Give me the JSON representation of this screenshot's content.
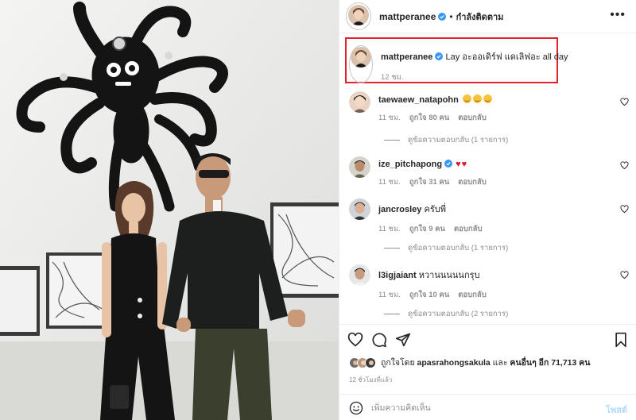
{
  "post": {
    "username": "mattperanee",
    "separator": "•",
    "follow_status": "กำลังติดตาม",
    "more_icon": "more-horizontal-icon"
  },
  "caption": {
    "username": "mattperanee",
    "text": "Lay อะออเดิร์ฟ แดเลิฟอะ all day",
    "time": "12 ชม."
  },
  "comments": [
    {
      "username": "taewaew_natapohn",
      "text": "",
      "emojis": [
        "grinning-face",
        "grinning-face",
        "grinning-face"
      ],
      "time": "11 ชม.",
      "likes": "ถูกใจ 80 คน",
      "reply": "ตอบกลับ",
      "view_replies": "ดูข้อความตอบกลับ (1 รายการ)",
      "verified": false
    },
    {
      "username": "ize_pitchapong",
      "text": "",
      "emojis": [
        "red-heart",
        "red-heart"
      ],
      "time": "11 ชม.",
      "likes": "ถูกใจ 31 คน",
      "reply": "ตอบกลับ",
      "view_replies": "",
      "verified": true
    },
    {
      "username": "jancrosley",
      "text": "ครับพี่",
      "emojis": [],
      "time": "11 ชม.",
      "likes": "ถูกใจ 9 คน",
      "reply": "ตอบกลับ",
      "view_replies": "ดูข้อความตอบกลับ (1 รายการ)",
      "verified": false
    },
    {
      "username": "l3igjaiant",
      "text": "หวานนนนนกรุบ",
      "emojis": [],
      "time": "11 ชม.",
      "likes": "ถูกใจ 10 คน",
      "reply": "ตอบกลับ",
      "view_replies": "ดูข้อความตอบกลับ (2 รายการ)",
      "verified": false
    }
  ],
  "likes_summary": {
    "prefix": "ถูกใจโดย",
    "liker": "apasrahongsakula",
    "conjunction": "และ",
    "others": "คนอื่นๆ อีก 71,713 คน"
  },
  "timestamp": "12 ชั่วโมงที่แล้ว",
  "composer": {
    "placeholder": "เพิ่มความคิดเห็น",
    "post_label": "โพสต์"
  },
  "colors": {
    "highlight_border": "#e2232b",
    "verified": "#3897f0",
    "muted_text": "#8e8e8e",
    "post_button": "#b3dbff"
  }
}
